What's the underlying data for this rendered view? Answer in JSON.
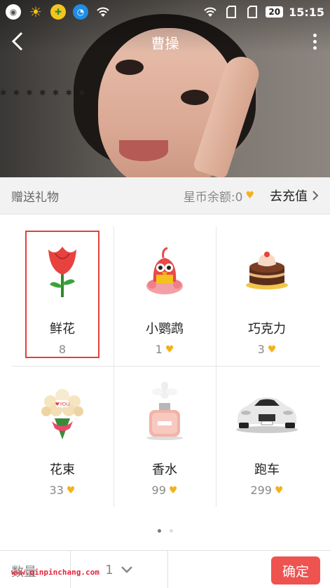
{
  "status_bar": {
    "battery": "20",
    "time": "15:15",
    "left_icons": [
      "owl-app-icon",
      "weather-sun-icon",
      "game-app-icon",
      "browser-app-icon",
      "wifi-icon"
    ],
    "right_icons": [
      "wifi-icon",
      "sim1-icon",
      "sim2-icon"
    ]
  },
  "nav": {
    "title": "曹操",
    "back_icon": "chevron-left-icon",
    "more_icon": "more-vertical-icon"
  },
  "gift_bar": {
    "title": "赠送礼物",
    "balance_label": "星币余额:0",
    "recharge_label": "去充值",
    "currency_icon": "heart-coin-icon"
  },
  "gifts": [
    {
      "name": "鲜花",
      "price": "8",
      "icon": "rose-icon",
      "selected": true,
      "show_coin": false
    },
    {
      "name": "小鹦鹉",
      "price": "1",
      "icon": "parrot-icon",
      "selected": false,
      "show_coin": true
    },
    {
      "name": "巧克力",
      "price": "3",
      "icon": "chocolate-cake-icon",
      "selected": false,
      "show_coin": true
    },
    {
      "name": "花束",
      "price": "33",
      "icon": "bouquet-icon",
      "selected": false,
      "show_coin": true
    },
    {
      "name": "香水",
      "price": "99",
      "icon": "perfume-icon",
      "selected": false,
      "show_coin": true
    },
    {
      "name": "跑车",
      "price": "299",
      "icon": "sports-car-icon",
      "selected": false,
      "show_coin": true
    }
  ],
  "pagination": {
    "pages": 2,
    "current": 1
  },
  "bottom": {
    "qty_label": "数量",
    "qty_value": "1",
    "confirm_label": "确定"
  },
  "watermark": "www.qinpinchang.com",
  "colors": {
    "accent": "#ee5350",
    "selected_border": "#e0413a",
    "coin": "#f2b21c"
  }
}
